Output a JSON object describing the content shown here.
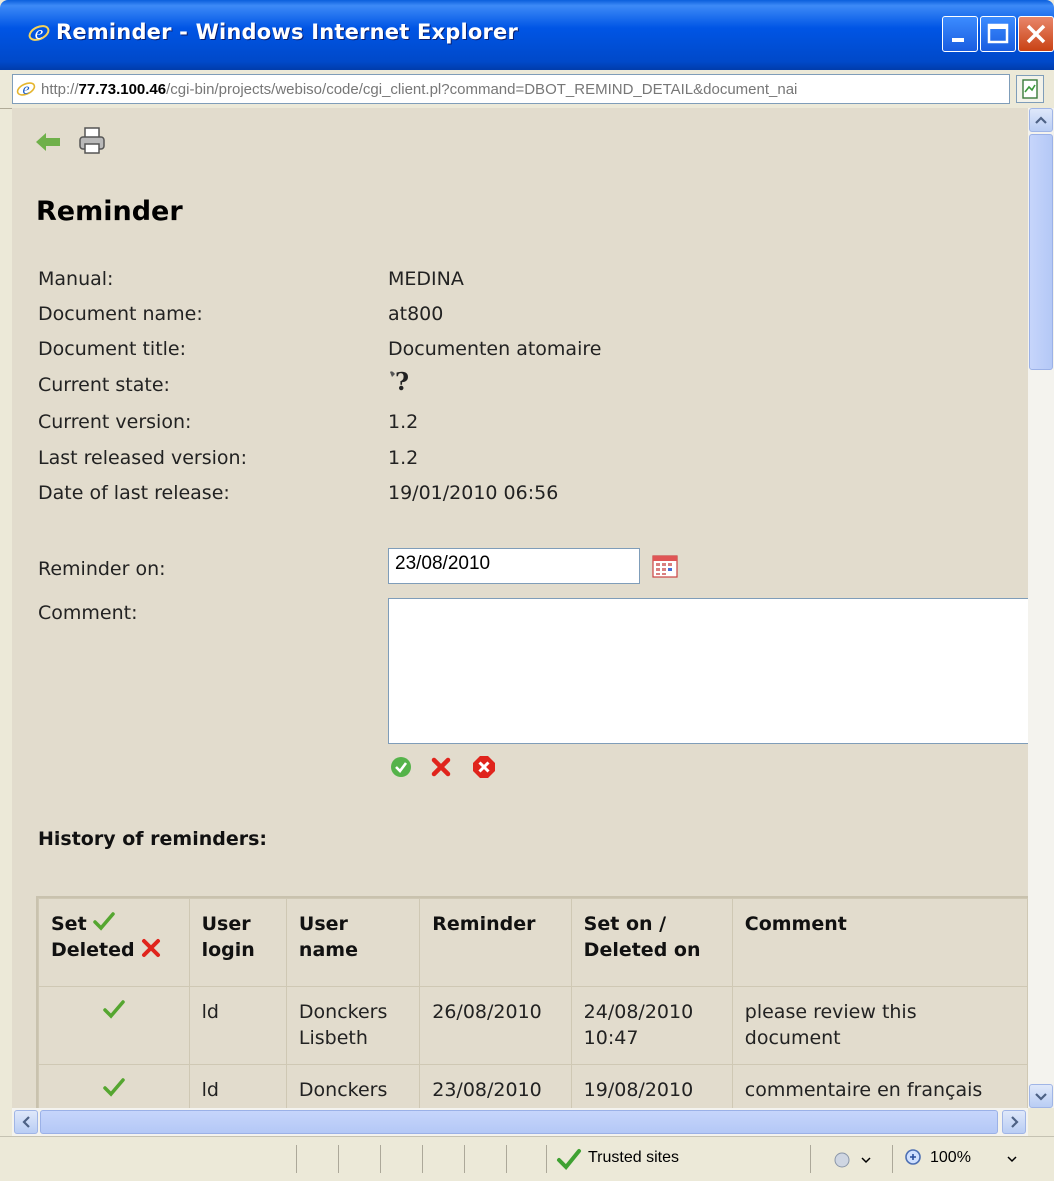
{
  "window": {
    "title": "Reminder - Windows Internet Explorer",
    "url_prefix": "http://",
    "url_host": "77.73.100.46",
    "url_path": "/cgi-bin/projects/webiso/code/cgi_client.pl?command=DBOT_REMIND_DETAIL&document_nai"
  },
  "page": {
    "heading": "Reminder",
    "fields": [
      {
        "label": "Manual:",
        "value": "MEDINA"
      },
      {
        "label": "Document name:",
        "value": "at800"
      },
      {
        "label": "Document title:",
        "value": "Documenten atomaire"
      },
      {
        "label": "Current state:",
        "value": ""
      },
      {
        "label": "Current version:",
        "value": "1.2"
      },
      {
        "label": "Last released version:",
        "value": "1.2"
      },
      {
        "label": "Date of last release:",
        "value": "19/01/2010 06:56"
      }
    ],
    "reminder_on_label": "Reminder on:",
    "reminder_on_value": "23/08/2010",
    "comment_label": "Comment:",
    "history_heading": "History of reminders:"
  },
  "table": {
    "headers": {
      "set": "Set",
      "deleted": "Deleted",
      "user_login": "User login",
      "user_name": "User name",
      "reminder": "Reminder",
      "set_on": "Set on / Deleted on",
      "comment": "Comment"
    },
    "rows": [
      {
        "user_login": "ld",
        "user_name": "Donckers Lisbeth",
        "reminder": "26/08/2010",
        "set_on": "24/08/2010 10:47",
        "comment": "please review this document"
      },
      {
        "user_login": "ld",
        "user_name": "Donckers",
        "reminder": "23/08/2010",
        "set_on": "19/08/2010",
        "comment": "commentaire en français"
      }
    ]
  },
  "status": {
    "zone": "Trusted sites",
    "zoom": "100%"
  },
  "colors": {
    "titlebar": "#0055e5",
    "page_bg": "#e2dccd",
    "check_green": "#55a630",
    "x_red": "#e0241c"
  }
}
